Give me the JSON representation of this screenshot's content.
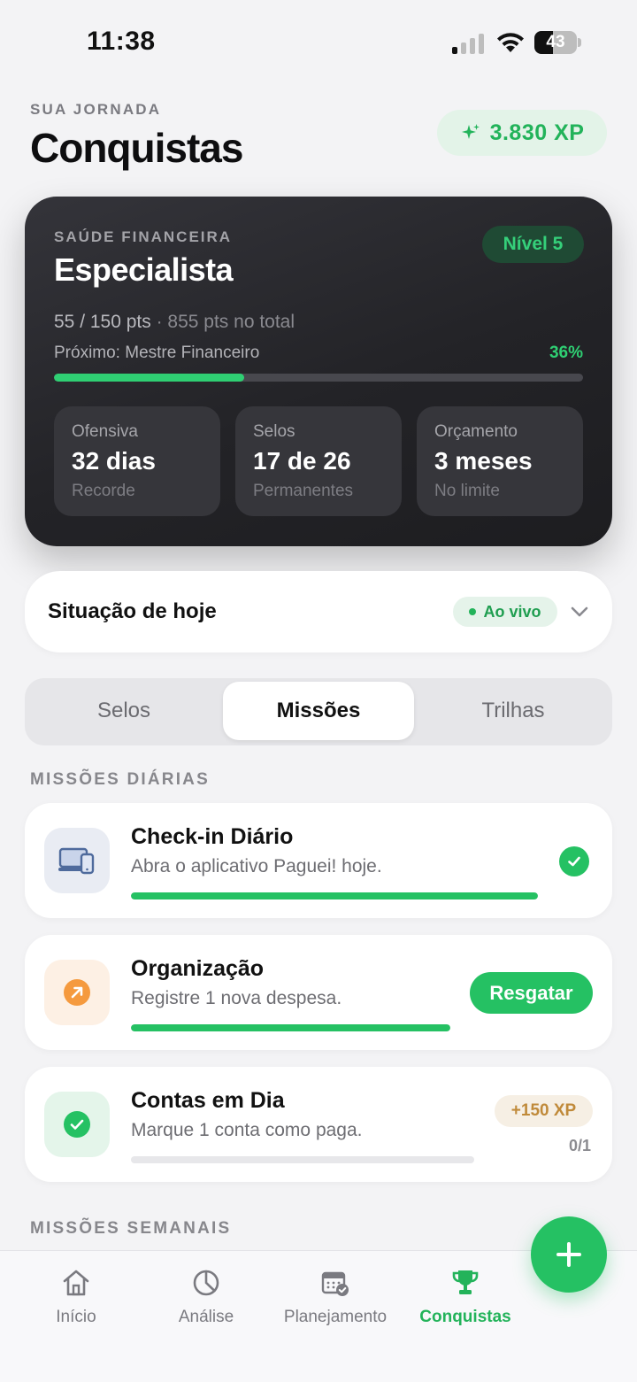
{
  "status_bar": {
    "time": "11:38",
    "battery": "43",
    "battery_level": 0.43
  },
  "header": {
    "eyebrow": "SUA JORNADA",
    "title": "Conquistas",
    "xp": "3.830 XP"
  },
  "health_card": {
    "eyebrow": "SAÚDE FINANCEIRA",
    "title": "Especialista",
    "level": "Nível 5",
    "points": "55 / 150 pts",
    "separator": " · ",
    "total": "855 pts no total",
    "next": "Próximo: Mestre Financeiro",
    "percent_label": "36%",
    "progress": 0.36,
    "stats": [
      {
        "label": "Ofensiva",
        "value": "32 dias",
        "sub": "Recorde"
      },
      {
        "label": "Selos",
        "value": "17 de 26",
        "sub": "Permanentes"
      },
      {
        "label": "Orçamento",
        "value": "3 meses",
        "sub": "No limite"
      }
    ]
  },
  "today": {
    "title": "Situação de hoje",
    "badge": "Ao vivo"
  },
  "tabs": [
    {
      "label": "Selos",
      "active": false
    },
    {
      "label": "Missões",
      "active": true
    },
    {
      "label": "Trilhas",
      "active": false
    }
  ],
  "daily_section": "MISSÕES DIÁRIAS",
  "missions": [
    {
      "title": "Check-in Diário",
      "desc": "Abra o aplicativo Paguei! hoje.",
      "progress": 1.0,
      "state": "done",
      "icon": "devices-icon"
    },
    {
      "title": "Organização",
      "desc": "Registre 1 nova despesa.",
      "progress": 1.0,
      "state": "claim",
      "action": "Resgatar",
      "icon": "arrow-up-right-icon"
    },
    {
      "title": "Contas em Dia",
      "desc": "Marque 1 conta como paga.",
      "progress": 0.0,
      "state": "pending",
      "reward": "+150 XP",
      "count": "0/1",
      "icon": "check-circle-icon"
    }
  ],
  "weekly_section": "MISSÕES SEMANAIS",
  "nav": [
    {
      "label": "Início",
      "icon": "home-icon",
      "active": false
    },
    {
      "label": "Análise",
      "icon": "pie-chart-icon",
      "active": false
    },
    {
      "label": "Planejamento",
      "icon": "calendar-check-icon",
      "active": false
    },
    {
      "label": "Conquistas",
      "icon": "trophy-icon",
      "active": true
    }
  ],
  "colors": {
    "accent": "#25c163",
    "dark_card": "#232327",
    "reward": "#c08a3a"
  }
}
